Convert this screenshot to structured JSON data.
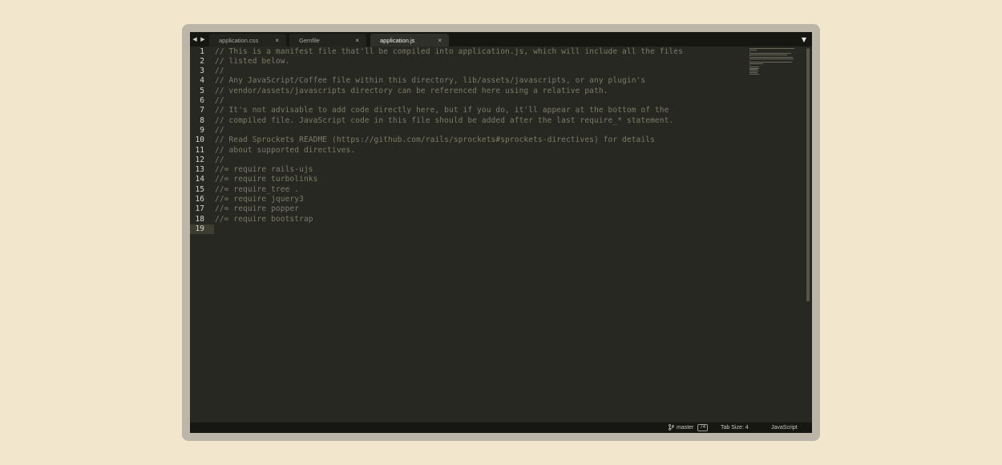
{
  "tabs": [
    {
      "label": "application.css",
      "active": false
    },
    {
      "label": "Gemfile",
      "active": false
    },
    {
      "label": "application.js",
      "active": true
    }
  ],
  "tab_close_glyph": "×",
  "nav": {
    "back_glyph": "◀",
    "forward_glyph": "▶",
    "menu_glyph": "▼"
  },
  "editor": {
    "lines": [
      {
        "num": "1",
        "text": "// This is a manifest file that'll be compiled into application.js, which will include all the files"
      },
      {
        "num": "2",
        "text": "// listed below."
      },
      {
        "num": "3",
        "text": "//"
      },
      {
        "num": "4",
        "text": "// Any JavaScript/Coffee file within this directory, lib/assets/javascripts, or any plugin's"
      },
      {
        "num": "5",
        "text": "// vendor/assets/javascripts directory can be referenced here using a relative path."
      },
      {
        "num": "6",
        "text": "//"
      },
      {
        "num": "7",
        "text": "// It's not advisable to add code directly here, but if you do, it'll appear at the bottom of the"
      },
      {
        "num": "8",
        "text": "// compiled file. JavaScript code in this file should be added after the last require_* statement."
      },
      {
        "num": "9",
        "text": "//"
      },
      {
        "num": "10",
        "text": "// Read Sprockets README (https://github.com/rails/sprockets#sprockets-directives) for details"
      },
      {
        "num": "11",
        "text": "// about supported directives."
      },
      {
        "num": "12",
        "text": "//"
      },
      {
        "num": "13",
        "text": "//= require rails-ujs"
      },
      {
        "num": "14",
        "text": "//= require turbolinks"
      },
      {
        "num": "15",
        "text": "//= require_tree ."
      },
      {
        "num": "16",
        "text": "//= require jquery3"
      },
      {
        "num": "17",
        "text": "//= require popper"
      },
      {
        "num": "18",
        "text": "//= require bootstrap"
      },
      {
        "num": "19",
        "text": ""
      }
    ],
    "current_line": 19
  },
  "status": {
    "branch": "master",
    "branch_badge": "74",
    "tab_size": "Tab Size: 4",
    "syntax": "JavaScript"
  },
  "icons": {
    "branch": "git-branch-icon",
    "close": "close-icon",
    "menu": "dropdown-icon"
  },
  "colors": {
    "background": "#f2e6cd",
    "editor_bg": "#272822",
    "comment": "#7d7a68",
    "line_number": "#d6d6cc"
  }
}
